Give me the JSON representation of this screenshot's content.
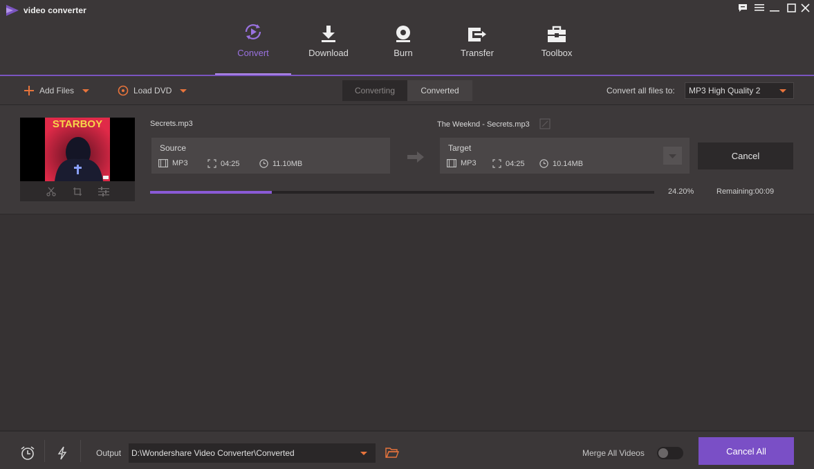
{
  "app": {
    "title": "video converter"
  },
  "nav": {
    "tabs": [
      {
        "label": "Convert",
        "icon": "convert-icon",
        "active": true
      },
      {
        "label": "Download",
        "icon": "download-icon",
        "active": false
      },
      {
        "label": "Burn",
        "icon": "burn-disc-icon",
        "active": false
      },
      {
        "label": "Transfer",
        "icon": "transfer-icon",
        "active": false
      },
      {
        "label": "Toolbox",
        "icon": "toolbox-icon",
        "active": false
      }
    ]
  },
  "toolbar": {
    "add_files": "Add Files",
    "load_dvd": "Load DVD",
    "segments": [
      "Converting",
      "Converted"
    ],
    "active_segment": "Converted",
    "convert_all_label": "Convert all files to:",
    "format_value": "MP3 High Quality 2"
  },
  "file": {
    "source_name": "Secrets.mp3",
    "target_name": "The Weeknd - Secrets.mp3",
    "thumbnail_text": "STARBOY",
    "source": {
      "title": "Source",
      "format": "MP3",
      "duration": "04:25",
      "size": "11.10MB"
    },
    "target": {
      "title": "Target",
      "format": "MP3",
      "duration": "04:25",
      "size": "10.14MB"
    },
    "cancel_label": "Cancel",
    "progress": 0.242,
    "progress_text": "24.20%",
    "remaining": "Remaining:00:09"
  },
  "footer": {
    "output_label": "Output",
    "output_path": "D:\\Wondershare Video Converter\\Converted",
    "merge_label": "Merge All Videos",
    "merge_enabled": false,
    "cancel_all": "Cancel All"
  },
  "colors": {
    "accent": "#7a4fc6",
    "accent_text": "#9a72e0",
    "orange": "#e8743c",
    "background": "#363233"
  }
}
